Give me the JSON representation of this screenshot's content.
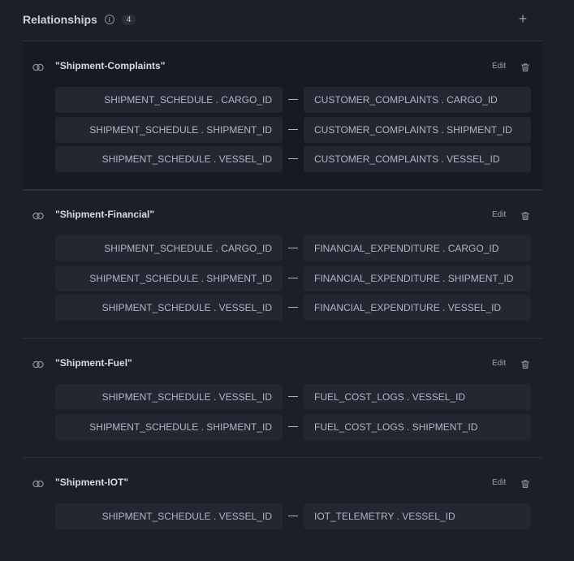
{
  "header": {
    "title": "Relationships",
    "count": "4",
    "info_glyph": "i",
    "add_glyph": "+"
  },
  "colors": {
    "background": "#1b1f27",
    "highlight_panel": "#161a21",
    "field_bg": "#222731",
    "divider": "#2c323c"
  },
  "relationships": [
    {
      "name": "\"Shipment-Complaints\"",
      "edit_label": "Edit",
      "mappings": [
        {
          "source": "SHIPMENT_SCHEDULE . CARGO_ID",
          "target": "CUSTOMER_COMPLAINTS . CARGO_ID"
        },
        {
          "source": "SHIPMENT_SCHEDULE . SHIPMENT_ID",
          "target": "CUSTOMER_COMPLAINTS . SHIPMENT_ID"
        },
        {
          "source": "SHIPMENT_SCHEDULE . VESSEL_ID",
          "target": "CUSTOMER_COMPLAINTS . VESSEL_ID"
        }
      ]
    },
    {
      "name": "\"Shipment-Financial\"",
      "edit_label": "Edit",
      "mappings": [
        {
          "source": "SHIPMENT_SCHEDULE . CARGO_ID",
          "target": "FINANCIAL_EXPENDITURE . CARGO_ID"
        },
        {
          "source": "SHIPMENT_SCHEDULE . SHIPMENT_ID",
          "target": "FINANCIAL_EXPENDITURE . SHIPMENT_ID"
        },
        {
          "source": "SHIPMENT_SCHEDULE . VESSEL_ID",
          "target": "FINANCIAL_EXPENDITURE . VESSEL_ID"
        }
      ]
    },
    {
      "name": "\"Shipment-Fuel\"",
      "edit_label": "Edit",
      "mappings": [
        {
          "source": "SHIPMENT_SCHEDULE . VESSEL_ID",
          "target": "FUEL_COST_LOGS . VESSEL_ID"
        },
        {
          "source": "SHIPMENT_SCHEDULE . SHIPMENT_ID",
          "target": "FUEL_COST_LOGS . SHIPMENT_ID"
        }
      ]
    },
    {
      "name": "\"Shipment-IOT\"",
      "edit_label": "Edit",
      "mappings": [
        {
          "source": "SHIPMENT_SCHEDULE . VESSEL_ID",
          "target": "IOT_TELEMETRY . VESSEL_ID"
        }
      ]
    }
  ]
}
